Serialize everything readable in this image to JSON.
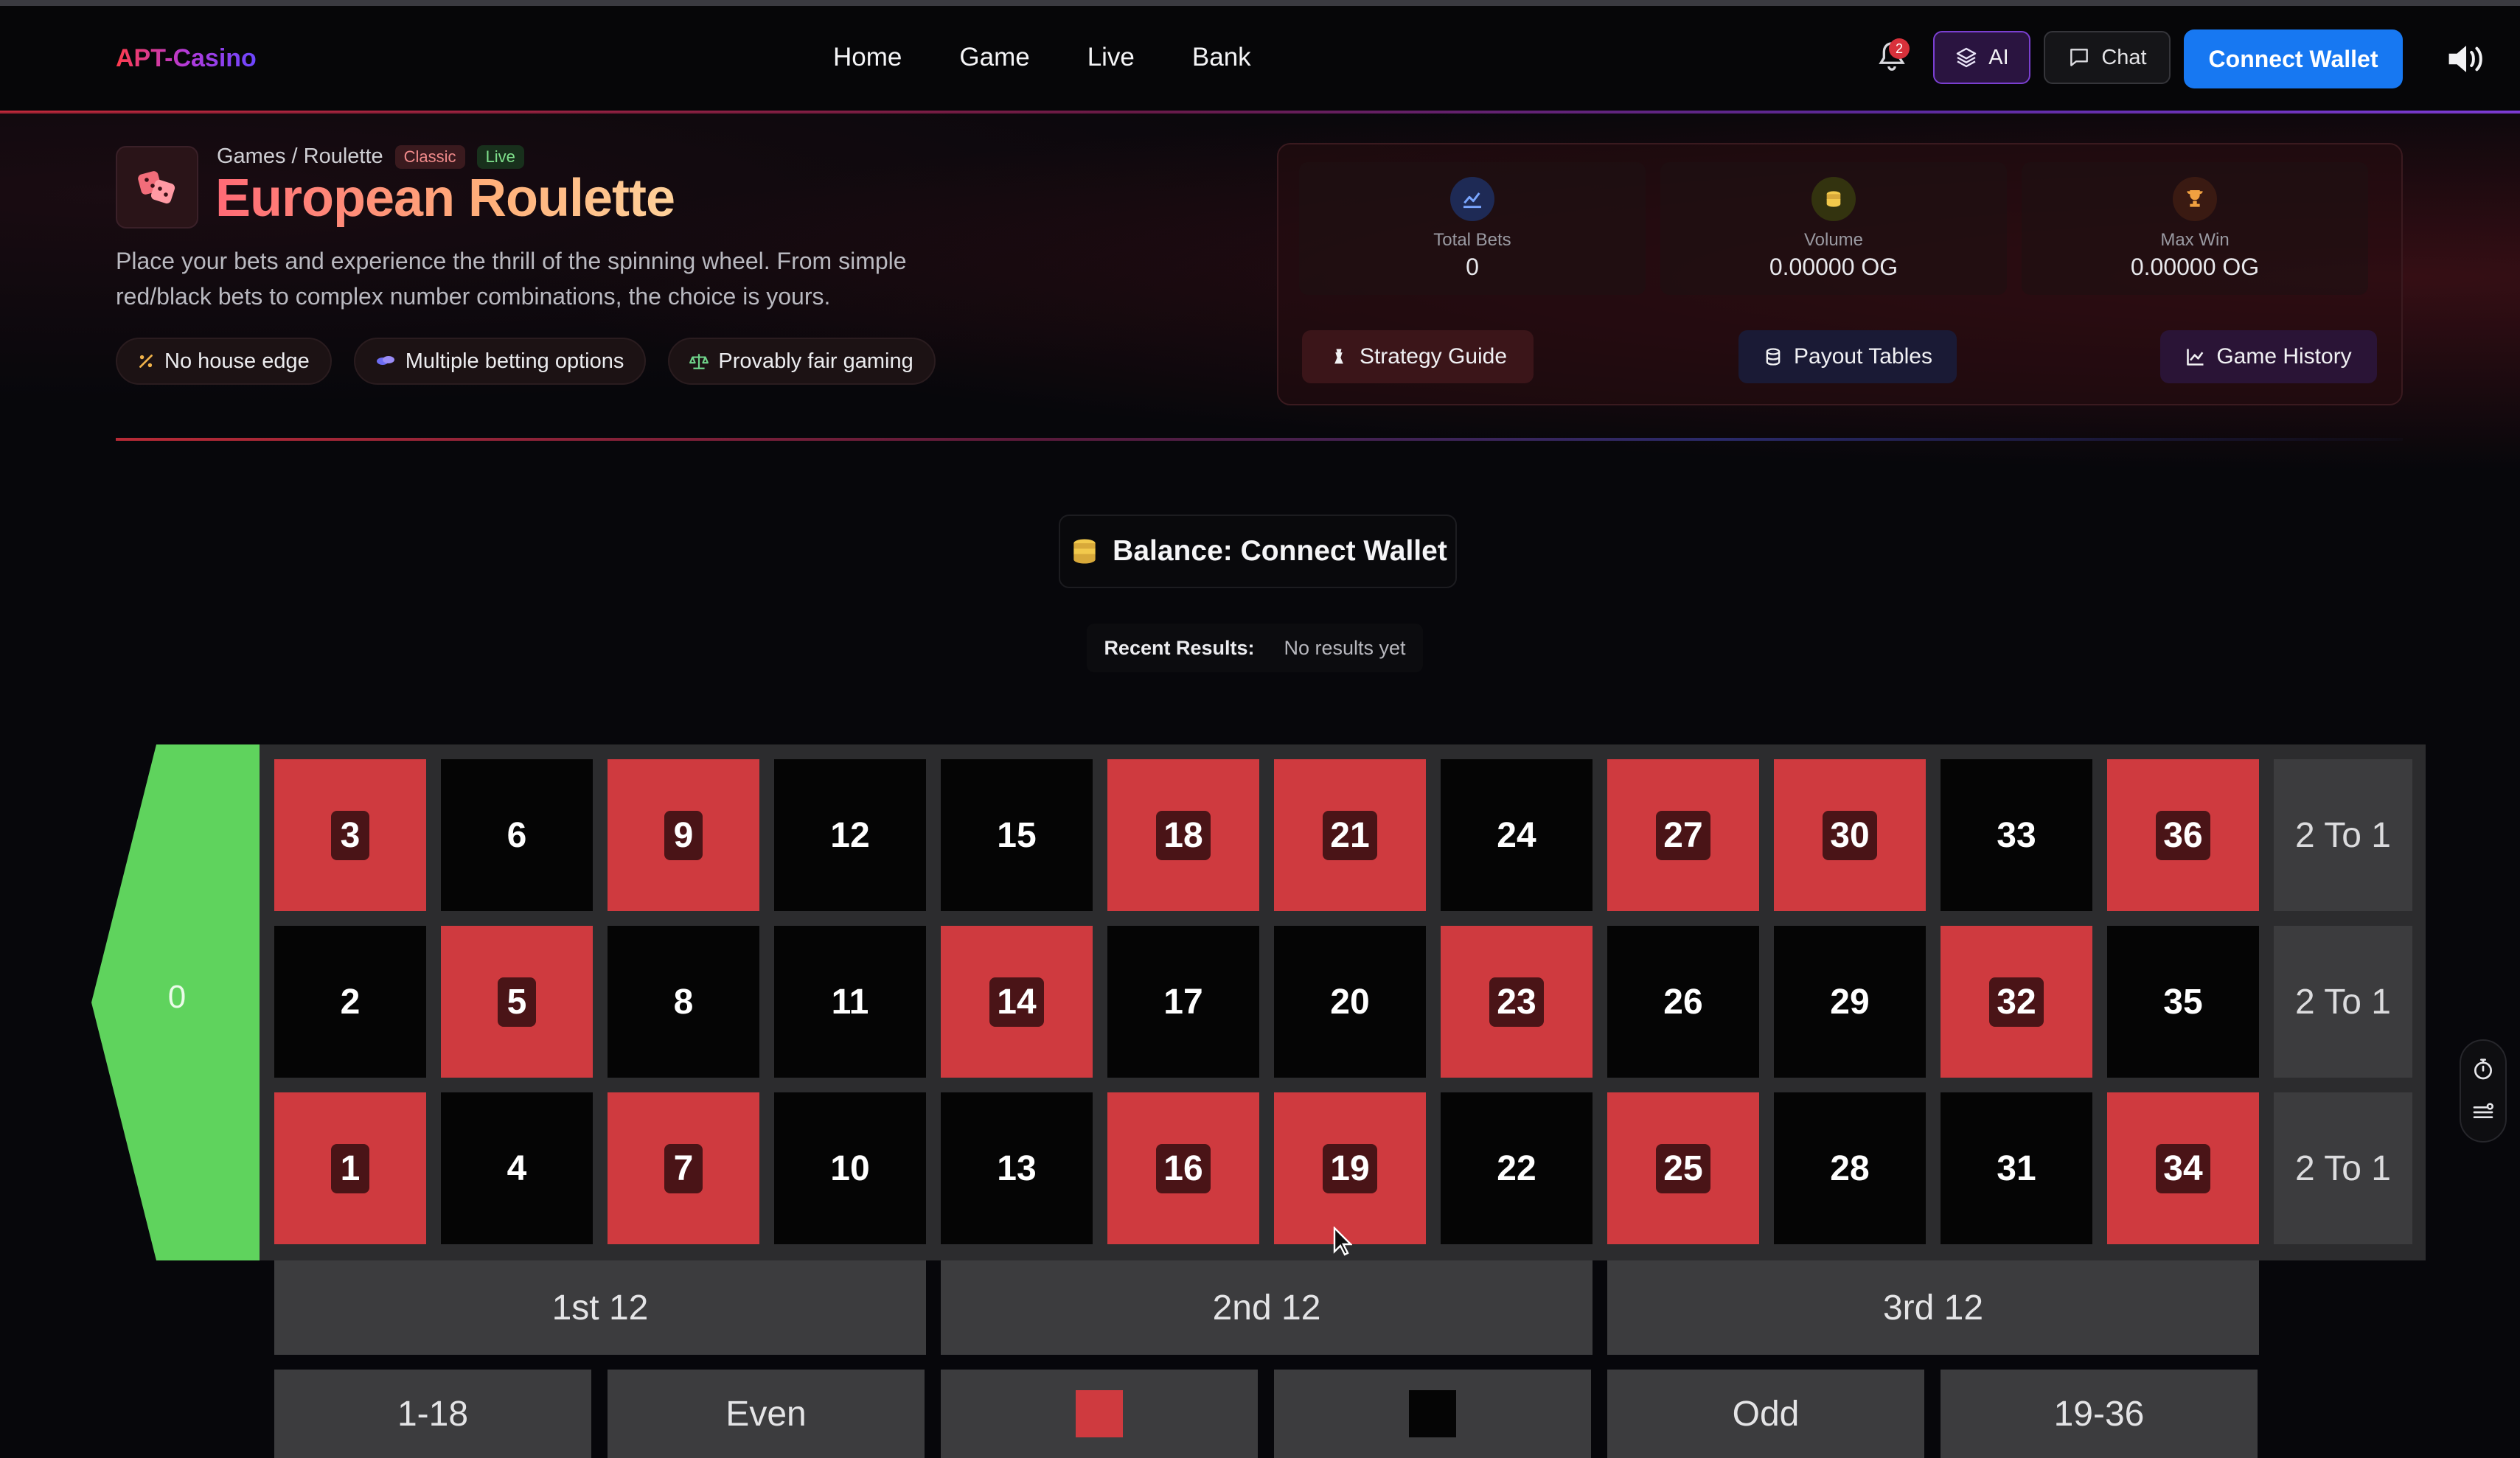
{
  "header": {
    "logo": "APT-Casino",
    "nav": [
      "Home",
      "Game",
      "Live",
      "Bank"
    ],
    "notifications_count": "2",
    "ai_label": "AI",
    "chat_label": "Chat",
    "connect_label": "Connect Wallet"
  },
  "game": {
    "breadcrumb": "Games / Roulette",
    "tags": [
      "Classic",
      "Live"
    ],
    "title": "European Roulette",
    "description_line1": "Place your bets and experience the thrill of the spinning wheel. From simple",
    "description_line2": "red/black bets to complex number combinations, the choice is yours.",
    "features": [
      "No house edge",
      "Multiple betting options",
      "Provably fair gaming"
    ]
  },
  "stats": {
    "total_bets_label": "Total Bets",
    "total_bets_value": "0",
    "volume_label": "Volume",
    "volume_value": "0.00000 OG",
    "max_win_label": "Max Win",
    "max_win_value": "0.00000 OG",
    "buttons": [
      "Strategy Guide",
      "Payout Tables",
      "Game History"
    ]
  },
  "balance": {
    "text": "Balance: Connect Wallet"
  },
  "recent": {
    "label": "Recent Results:",
    "value": "No results yet"
  },
  "board": {
    "zero": "0",
    "rows": [
      [
        {
          "n": "3",
          "c": "red"
        },
        {
          "n": "6",
          "c": "black"
        },
        {
          "n": "9",
          "c": "red"
        },
        {
          "n": "12",
          "c": "black"
        },
        {
          "n": "15",
          "c": "black"
        },
        {
          "n": "18",
          "c": "red"
        },
        {
          "n": "21",
          "c": "red"
        },
        {
          "n": "24",
          "c": "black"
        },
        {
          "n": "27",
          "c": "red"
        },
        {
          "n": "30",
          "c": "red"
        },
        {
          "n": "33",
          "c": "black"
        },
        {
          "n": "36",
          "c": "red"
        }
      ],
      [
        {
          "n": "2",
          "c": "black"
        },
        {
          "n": "5",
          "c": "red"
        },
        {
          "n": "8",
          "c": "black"
        },
        {
          "n": "11",
          "c": "black"
        },
        {
          "n": "14",
          "c": "red"
        },
        {
          "n": "17",
          "c": "black"
        },
        {
          "n": "20",
          "c": "black"
        },
        {
          "n": "23",
          "c": "red"
        },
        {
          "n": "26",
          "c": "black"
        },
        {
          "n": "29",
          "c": "black"
        },
        {
          "n": "32",
          "c": "red"
        },
        {
          "n": "35",
          "c": "black"
        }
      ],
      [
        {
          "n": "1",
          "c": "red"
        },
        {
          "n": "4",
          "c": "black"
        },
        {
          "n": "7",
          "c": "red"
        },
        {
          "n": "10",
          "c": "black"
        },
        {
          "n": "13",
          "c": "black"
        },
        {
          "n": "16",
          "c": "red"
        },
        {
          "n": "19",
          "c": "red"
        },
        {
          "n": "22",
          "c": "black"
        },
        {
          "n": "25",
          "c": "red"
        },
        {
          "n": "28",
          "c": "black"
        },
        {
          "n": "31",
          "c": "black"
        },
        {
          "n": "34",
          "c": "red"
        }
      ]
    ],
    "column_bet": "2 To 1",
    "dozens": [
      "1st 12",
      "2nd 12",
      "3rd 12"
    ],
    "outside": [
      "1-18",
      "Even",
      "",
      "",
      "Odd",
      "19-36"
    ],
    "colors": {
      "red": "#cf3a3f",
      "black": "#050505",
      "green": "#5fd35d"
    }
  }
}
